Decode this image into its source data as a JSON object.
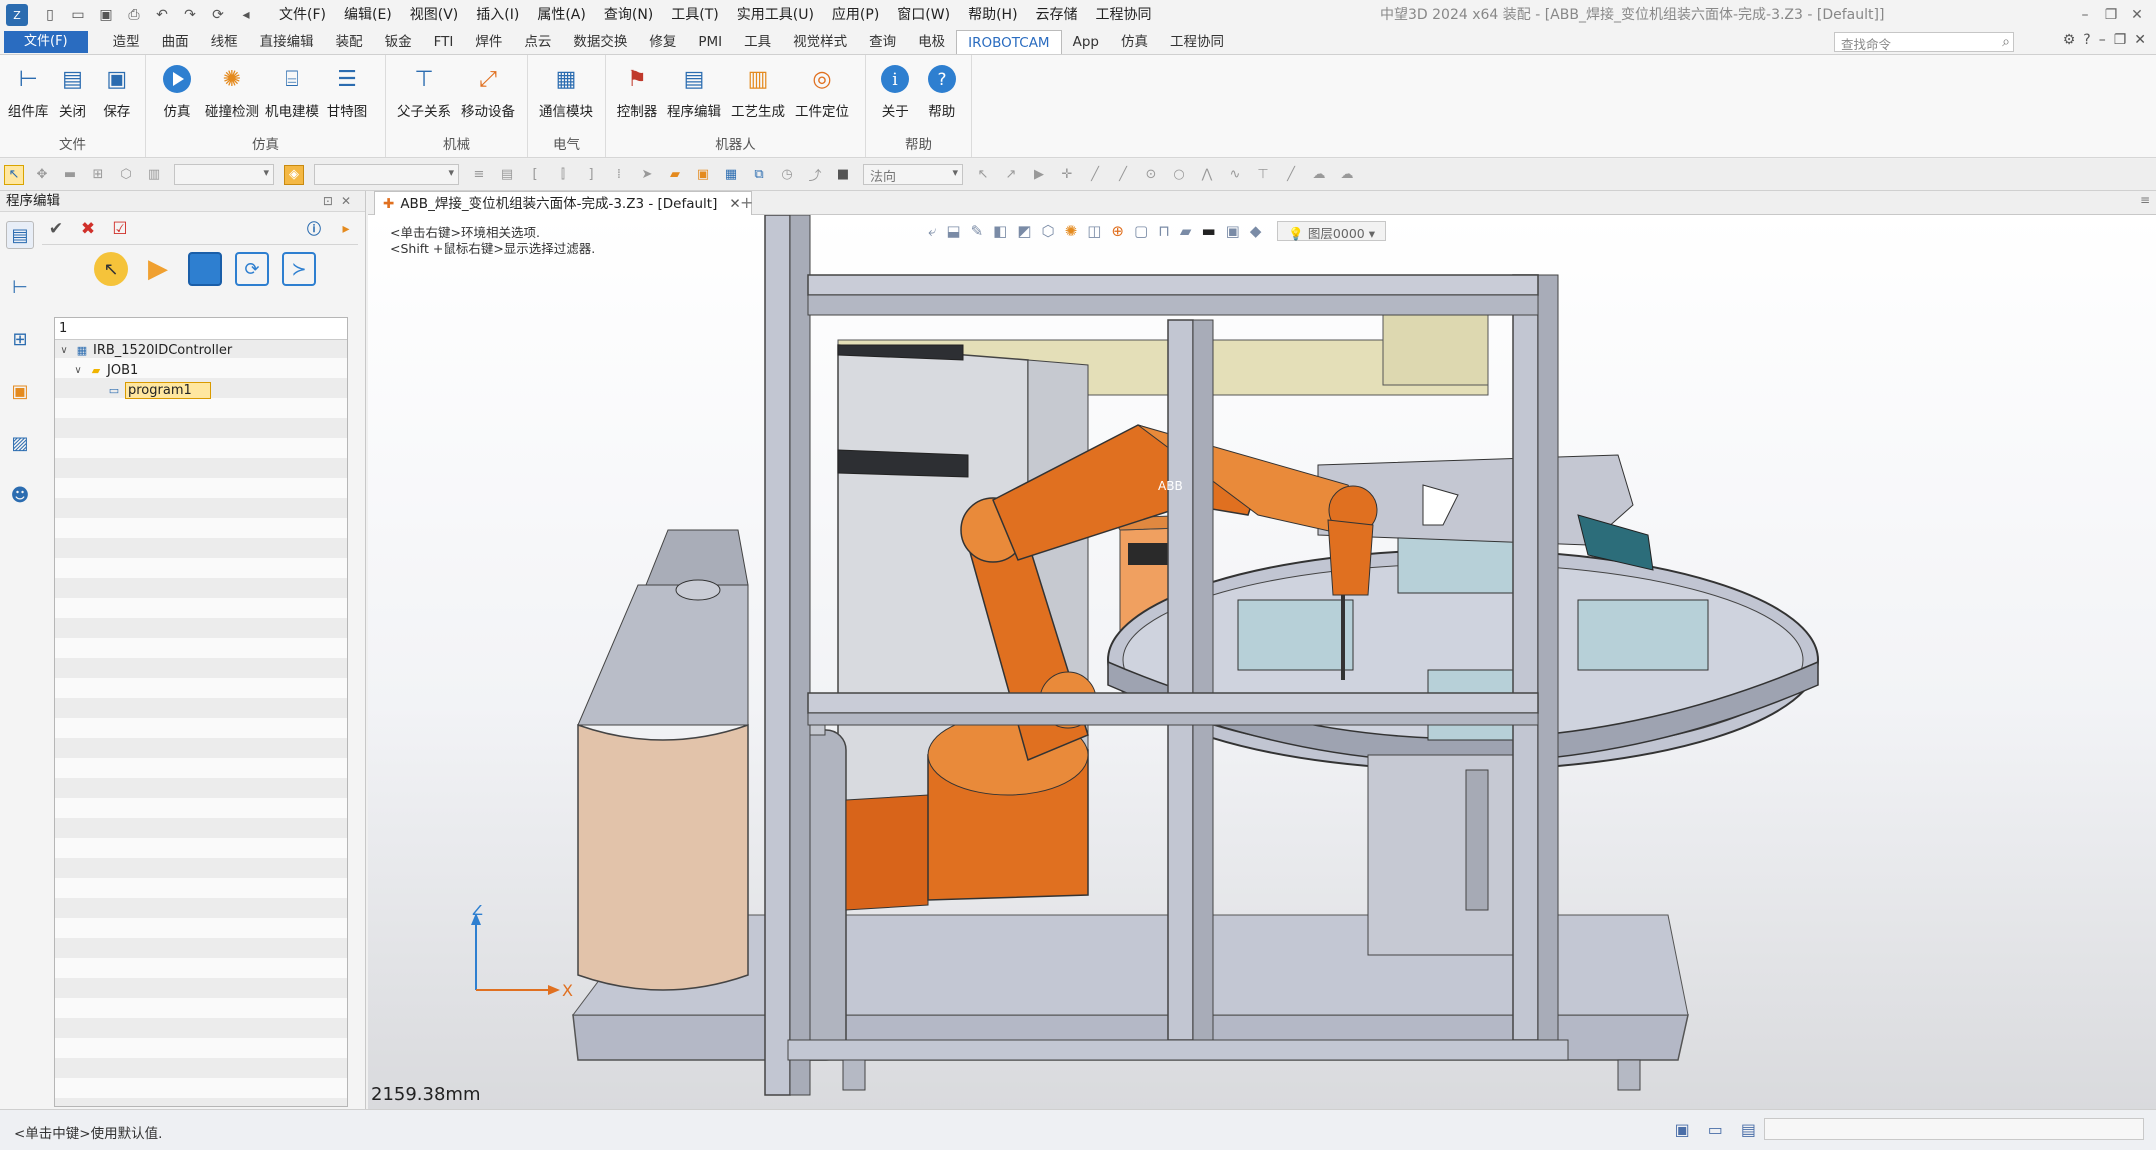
{
  "titlebar": {
    "title": "中望3D 2024 x64       装配 - [ABB_焊接_变位机组装六面体-完成-3.Z3 - [Default]]",
    "menus": [
      "文件(F)",
      "编辑(E)",
      "视图(V)",
      "插入(I)",
      "属性(A)",
      "查询(N)",
      "工具(T)",
      "实用工具(U)",
      "应用(P)",
      "窗口(W)",
      "帮助(H)",
      "云存储",
      "工程协同"
    ]
  },
  "ribbon_tabs": {
    "file": "文件(F)",
    "tabs": [
      "造型",
      "曲面",
      "线框",
      "直接编辑",
      "装配",
      "钣金",
      "FTI",
      "焊件",
      "点云",
      "数据交换",
      "修复",
      "PMI",
      "工具",
      "视觉样式",
      "查询",
      "电极",
      "IROBOTCAM",
      "App",
      "仿真",
      "工程协同"
    ],
    "active": "IROBOTCAM",
    "search_placeholder": "查找命令"
  },
  "ribbon": {
    "groups": [
      {
        "name": "文件",
        "buttons": [
          "组件库",
          "关闭",
          "保存"
        ]
      },
      {
        "name": "仿真",
        "buttons": [
          "仿真",
          "碰撞检测",
          "机电建模",
          "甘特图"
        ]
      },
      {
        "name": "机械",
        "buttons": [
          "父子关系",
          "移动设备"
        ]
      },
      {
        "name": "电气",
        "buttons": [
          "通信模块"
        ]
      },
      {
        "name": "机器人",
        "buttons": [
          "控制器",
          "程序编辑",
          "工艺生成",
          "工件定位"
        ]
      },
      {
        "name": "帮助",
        "buttons": [
          "关于",
          "帮助"
        ]
      }
    ]
  },
  "toolbar": {
    "direction_select": "法向"
  },
  "left_panel": {
    "title": "程序编辑",
    "tree_input": "1",
    "tree": [
      {
        "label": "IRB_1520IDController",
        "level": 0,
        "expanded": true
      },
      {
        "label": "JOB1",
        "level": 1,
        "expanded": true
      },
      {
        "label": "program1",
        "level": 2,
        "selected": true
      }
    ]
  },
  "document": {
    "tab_label": "ABB_焊接_变位机组装六面体-完成-3.Z3 - [Default]"
  },
  "viewport": {
    "hint_line1": "<单击右键>环境相关选项.",
    "hint_line2": "<Shift +鼠标右键>显示选择过滤器.",
    "layer": "图层0000",
    "distance": "2159.38mm",
    "axis_z": "Z",
    "axis_x": "X",
    "robot_brand": "ABB"
  },
  "status": {
    "text": "<单击中键>使用默认值."
  },
  "colors": {
    "accent": "#2a6cc0",
    "robot": "#e07020",
    "frame": "#b8bcc8",
    "selection": "#ffe7a0"
  }
}
